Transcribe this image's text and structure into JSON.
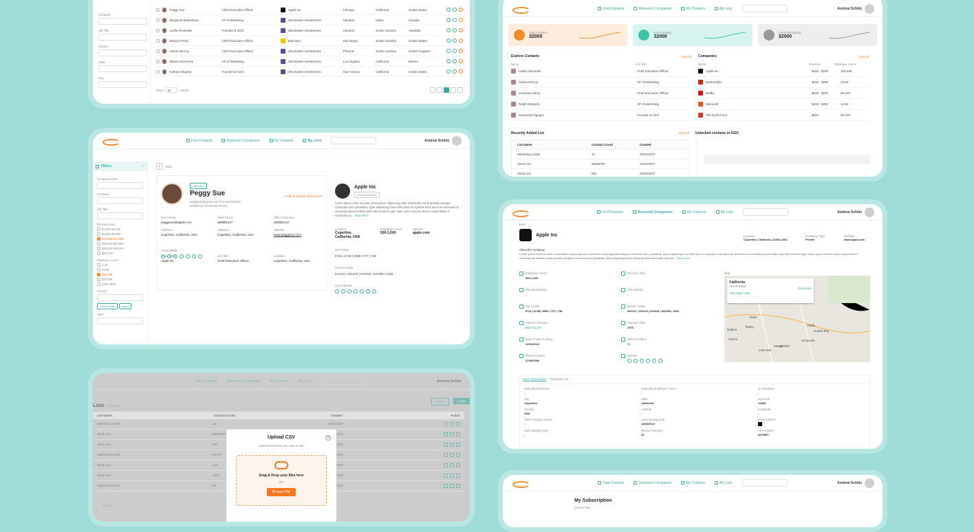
{
  "nav": {
    "find_contacts": "Find Contacts",
    "research_companies": "Research Companies",
    "my_contacts": "My Contacts",
    "my_lists": "My Lists",
    "user": "Andrew Schlitz"
  },
  "panel1": {
    "filters": [
      "Company",
      "Job Title",
      "Country",
      "State",
      "City"
    ],
    "rows": [
      {
        "name": "Peggy Sue",
        "title": "Chief Executive Officer",
        "company": "Apple Inc",
        "city": "Chicago",
        "state": "California",
        "country": "United States"
      },
      {
        "name": "Benjamin Battlesbury",
        "title": "VP of Marketing",
        "company": "Winchester Investments",
        "city": "Houston",
        "state": "Idaho",
        "country": "Canada"
      },
      {
        "name": "Leslie Alexander",
        "title": "Founder & CEO",
        "company": "Winchester Investments",
        "city": "Houston",
        "state": "South Carolina",
        "country": "Australia"
      },
      {
        "name": "Eleanor Pena",
        "title": "Chief Executive Officer",
        "company": "Blue Box",
        "city": "San Diego",
        "state": "South Carolina",
        "country": "United States"
      },
      {
        "name": "Arlene McCoy",
        "title": "Chief Executive Officer",
        "company": "Winchester Investments",
        "city": "Phoenix",
        "state": "South Carolina",
        "country": "United Kingdom"
      },
      {
        "name": "Marvin McKinney",
        "title": "VP of Marketing",
        "company": "Winchester Investments",
        "city": "Los Angeles",
        "state": "California",
        "country": "Mexico"
      },
      {
        "name": "Kathryn Murphy",
        "title": "Founder & CEO",
        "company": "Winchester Investments",
        "city": "San Antonio",
        "state": "California",
        "country": "United States"
      }
    ],
    "show": "Show",
    "show_count": "50",
    "entries": "entries"
  },
  "panel2": {
    "filters_title": "Filters",
    "back": "Back",
    "unlocked": "Unlocked",
    "name": "Peggy Sue",
    "email_line": "peggysue@gmail.com (Personal Email)",
    "phone_line": "360852147 (Personal Phone)",
    "add_update": "+ Add or Update Information",
    "fields": [
      {
        "label": "Work Email",
        "value": "peggysue@apple.com"
      },
      {
        "label": "Work Phone",
        "value": "360852147"
      },
      {
        "label": "Office Extension",
        "value": "360852147"
      },
      {
        "label": "Address 1",
        "value": "Cupertino, California, USA"
      },
      {
        "label": "Address 2",
        "value": "Cupertino, California, USA"
      },
      {
        "label": "Website",
        "value": "www.peggysue.com"
      },
      {
        "label": "Organization",
        "value": "Apple Inc"
      },
      {
        "label": "Job Title",
        "value": "Chief Execution Officer"
      },
      {
        "label": "Location",
        "value": "Cupertino, California, USA"
      }
    ],
    "social_media": "Social Media",
    "filter_labels": {
      "company_name": "Company Name",
      "company": "Company",
      "job_title": "Job Title",
      "revenue_size": "Revenue Size",
      "employee_count": "Employee Count",
      "country": "Country",
      "state": "State"
    },
    "revenue": [
      {
        "label": "$1,000-$4,999",
        "on": false
      },
      {
        "label": "$5,000-$9,999",
        "on": false
      },
      {
        "label": "$10,000-$19,999",
        "on": true
      },
      {
        "label": "$20,000-$29,999",
        "on": false
      },
      {
        "label": "$30,000-$49,999",
        "on": false
      },
      {
        "label": "$50,000+",
        "on": false
      }
    ],
    "employees": [
      {
        "label": "2-49",
        "on": false
      },
      {
        "label": "50-99",
        "on": false
      },
      {
        "label": "100-499",
        "on": true
      },
      {
        "label": "500-999",
        "on": false
      },
      {
        "label": "1000-4999",
        "on": false
      }
    ],
    "country_tags": [
      "United State",
      "Nepal"
    ],
    "company": {
      "name": "Apple Inc",
      "subtitle": "12 just followers",
      "desc": "Lorem ipsum dolor sit amet consectetur. Adipiscing dolor sollicitudin morbi gravida volutpat commodo enim phasellus. Quis adipiscing fusce felis dolor ris egestas risus lacus sit venenatis at venenatis placerat diam quis hab tincidunt eget. Nunc quis a laoreet donec suspendisse il commodo ac...",
      "read_more": "Read More",
      "location_label": "Location",
      "location": "Cupertino, California, USA",
      "employee_label": "Employee Count",
      "employee": "500-1,000",
      "website_label": "Website",
      "website": "apple.com",
      "sic_label": "SIC Codes",
      "sic": "8721 | 8748 | 8999 | 737 | 738",
      "naics_label": "NAICS Codes",
      "naics": "541211 | 541219 | 541618 | 541690 | 5182",
      "social": "Social Media"
    }
  },
  "panel3": {
    "title": "Lists",
    "results": "(7 results)",
    "cancel": "Cancel",
    "create": "Create",
    "headers": [
      "List Name",
      "Contact Count",
      "Created",
      "Action"
    ],
    "rows": [
      {
        "name": "Marketing Leads",
        "count": "12",
        "created": "2021/02/07"
      },
      {
        "name": "Client List",
        "count": "65458787",
        "created": "2021/02/07"
      },
      {
        "name": "Client List",
        "count": "564",
        "created": "2021/02/07"
      },
      {
        "name": "Marketing Leads",
        "count": "88721",
        "created": "2021/02/07"
      },
      {
        "name": "Client List",
        "count": "114",
        "created": "2021/02/07"
      },
      {
        "name": "Client List",
        "count": "3649",
        "created": "2021/02/07"
      },
      {
        "name": "Marketing Leads",
        "count": "89",
        "created": "2021/02/07"
      }
    ],
    "entries": "entries",
    "modal": {
      "title": "Upload CSV",
      "subtitle": "Upload documents you want to add.",
      "drag": "Drag & Drop your files here",
      "or": "OR",
      "browse": "Browse File"
    }
  },
  "panel4": {
    "stats": [
      {
        "label": "Total Contacts",
        "value": "32000",
        "color": "#f58a2a",
        "bg": "#fdebdc"
      },
      {
        "label": "New Contacts",
        "value": "32000",
        "color": "#3cc3a8",
        "bg": "#d8f4ee"
      },
      {
        "label": "Credit Remaining",
        "value": "32000",
        "color": "#999",
        "bg": "#eee"
      }
    ],
    "explore_title": "Explore Contacts",
    "view_all": "View All",
    "name_h": "Name",
    "job_h": "Job Title",
    "contacts": [
      {
        "name": "Leslie Alexander",
        "job": "Chief Executive Officer"
      },
      {
        "name": "Arlene McCoy",
        "job": "VP of Marketing"
      },
      {
        "name": "Courtney Henry",
        "job": "Chief Executive Officer"
      },
      {
        "name": "Ralph Edwards",
        "job": "VP of Marketing"
      },
      {
        "name": "Savannah Nguyen",
        "job": "Founder & CEO"
      }
    ],
    "companies_title": "Companies",
    "rev_h": "Revenue",
    "emp_h": "Employee Count",
    "companies": [
      {
        "name": "Apple Inc",
        "rev": "$100 - $200",
        "emp": "100-499",
        "color": "#111"
      },
      {
        "name": "McDonald's",
        "rev": "$100 - $200",
        "emp": "24-50",
        "color": "#d62300"
      },
      {
        "name": "Netflix",
        "rev": "$100 - $200",
        "emp": "80-100",
        "color": "#e50914"
      },
      {
        "name": "Microsoft",
        "rev": "$100 - $200",
        "emp": "11-50",
        "color": "#f25022"
      },
      {
        "name": "The North Face",
        "rev": "$1M+",
        "emp": "80-100",
        "color": "#e4322b"
      }
    ],
    "recent_title": "Recently Added List",
    "unlocked_title": "Unlocked contacts in 2023",
    "list_h": [
      "List Name",
      "Contact Count",
      "Created"
    ],
    "lists": [
      {
        "name": "Marketing Leads",
        "count": "12",
        "created": "2021/02/07"
      },
      {
        "name": "Client List",
        "count": "65458787",
        "created": "2021/02/07"
      },
      {
        "name": "Client List",
        "count": "564",
        "created": "2021/02/07"
      }
    ]
  },
  "panel5": {
    "back": "Back",
    "name": "Apple Inc",
    "location_label": "Location",
    "location": "Cupertino, California, 12365, USA",
    "type_label": "Company Type",
    "type": "Private",
    "website_label": "Website",
    "website": "www.apple.com",
    "about_title": "About the Company",
    "about": "Lorem ipsum dolor sit amet consectetur. Adipiscing dolor sollicitudin morbi gravida volutpat commodo enim phasellus. Quis adipiscing fusce felis dolor ris egestas risus lacus sit venenatis at venenatis placerat diam quis hab tincidunt eget. Nunc quis a laoreet donec suspendisse il commodo ac facilisis morbi gravida volutpat commodo enim phasellus. Quis adipiscing fusce facilisi gravida lacus ante felis fon...",
    "read_more": "Read More",
    "left": [
      {
        "label": "Employee Count",
        "value": "500-1,000"
      },
      {
        "label": "Primary Industry",
        "value": "-"
      },
      {
        "label": "SIC Codes",
        "value": "8721 | 8748 | 8999 | 737 | 738"
      },
      {
        "label": "Parent Company",
        "value": "680-773-170"
      },
      {
        "label": "Date of Last Funding",
        "value": "14/04/2022"
      },
      {
        "label": "Phone Number",
        "value": "074097584"
      }
    ],
    "right": [
      {
        "label": "Revenue Size",
        "value": "-"
      },
      {
        "label": "Sub Industry",
        "value": "-"
      },
      {
        "label": "NAICS Codes",
        "value": "541211 | 541219 | 541618 | 541690 | 5182"
      },
      {
        "label": "Founded Date",
        "value": "1976"
      },
      {
        "label": "Office Location",
        "value": "58"
      },
      {
        "label": "Socials",
        "value": ""
      }
    ],
    "map_label": "Map",
    "map_place": "California",
    "map_country": "United States",
    "map_link": "View larger map",
    "directions": "Directions",
    "map_cities": [
      "Fresno",
      "Clovis",
      "Madera",
      "Tarpey",
      "Visalia",
      "Hanford",
      "Sanger",
      "Lone Star",
      "Centerville",
      "Granite Bay"
    ],
    "tabs": [
      "More Information",
      "Employee List"
    ],
    "info": [
      {
        "label": "Estimated Revenue",
        "value": "-"
      },
      {
        "label": "Estimated Employee Count",
        "value": "-"
      },
      {
        "label": "Is Subsidiary",
        "value": "-"
      },
      {
        "label": "City",
        "value": "Cupertino"
      },
      {
        "label": "State",
        "value": "California"
      },
      {
        "label": "Zip Code",
        "value": "12365"
      },
      {
        "label": "Country",
        "value": "USA"
      },
      {
        "label": "Latitude",
        "value": "-"
      },
      {
        "label": "Longitude",
        "value": "-"
      },
      {
        "label": "Total Funding Amount",
        "value": "-"
      },
      {
        "label": "Last Funding Date",
        "value": "14/04/2022"
      },
      {
        "label": "Stock symbol",
        "value": ""
      },
      {
        "label": "Last Funding Type",
        "value": "-"
      },
      {
        "label": "Recent Investors",
        "value": "10"
      },
      {
        "label": "All Investors",
        "value": "8379057"
      }
    ]
  },
  "panel6": {
    "title": "My Subscription",
    "subtitle": "Current Plan"
  }
}
